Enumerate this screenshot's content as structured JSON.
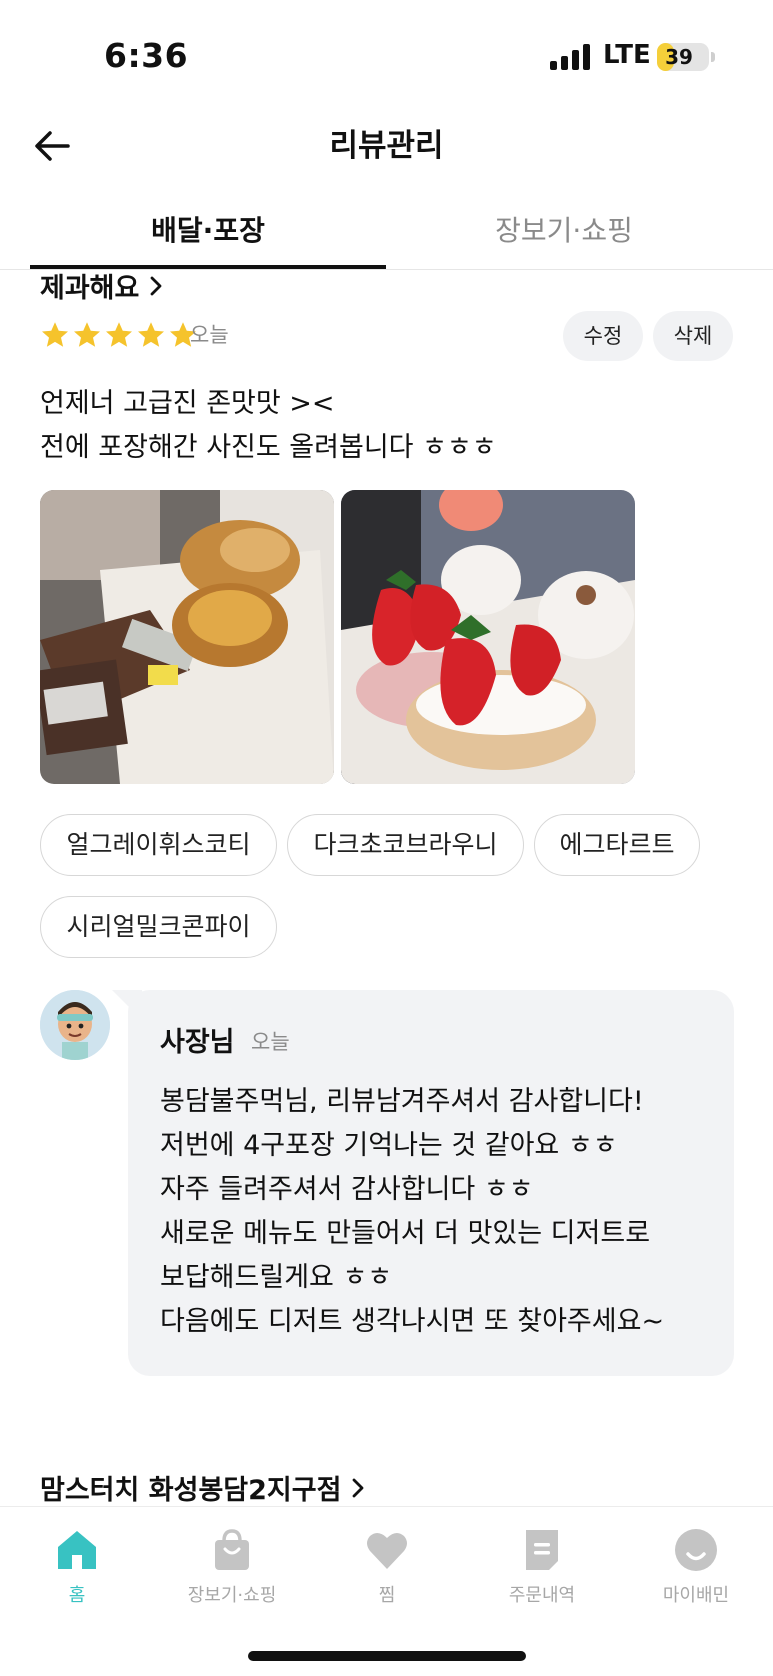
{
  "status": {
    "time": "6:36",
    "network": "LTE",
    "battery": "39",
    "battery_level": 0.39
  },
  "header": {
    "title": "리뷰관리"
  },
  "tabs": [
    {
      "label": "배달·포장",
      "active": true
    },
    {
      "label": "장보기·쇼핑",
      "active": false
    }
  ],
  "review": {
    "store_name": "제과해요",
    "rating": 5,
    "date": "오늘",
    "edit_label": "수정",
    "delete_label": "삭제",
    "text_lines": [
      "언제너 고급진 존맛맛 ><",
      "전에 포장해간 사진도 올려봅니다 ㅎㅎㅎ"
    ],
    "photos": [
      {
        "icon": "pastry-box-photo"
      },
      {
        "icon": "strawberry-cream-puff-photo"
      }
    ],
    "menu_tags": [
      "얼그레이휘스코티",
      "다크초코브라우니",
      "에그타르트",
      "시리얼밀크콘파이"
    ]
  },
  "reply": {
    "author": "사장님",
    "date": "오늘",
    "lines": [
      "봉담불주먹님,  리뷰남겨주셔서 감사합니다!",
      "저번에 4구포장 기억나는 것 같아요 ㅎㅎ",
      "자주 들려주셔서 감사합니다 ㅎㅎ",
      "새로운 메뉴도 만들어서 더 맛있는 디저트로",
      "보답해드릴게요 ㅎㅎ",
      "다음에도 디저트 생각나시면 또 찾아주세요~"
    ]
  },
  "next_store": {
    "name": "맘스터치 화성봉담2지구점"
  },
  "bottom_nav": [
    {
      "label": "홈",
      "icon": "home-icon",
      "active": true
    },
    {
      "label": "장보기·쇼핑",
      "icon": "shopping-bag-icon",
      "active": false
    },
    {
      "label": "찜",
      "icon": "heart-icon",
      "active": false
    },
    {
      "label": "주문내역",
      "icon": "receipt-icon",
      "active": false
    },
    {
      "label": "마이배민",
      "icon": "profile-smile-icon",
      "active": false
    }
  ],
  "colors": {
    "accent": "#38c2c2",
    "star": "#f5c32c",
    "battery": "#f5cf3a",
    "bubble": "#f2f3f5"
  }
}
